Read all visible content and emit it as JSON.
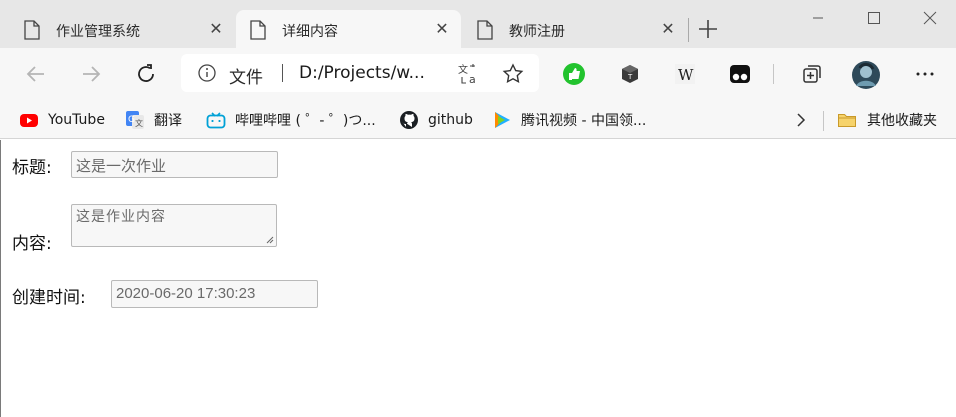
{
  "tabs": [
    {
      "title": "作业管理系统",
      "close": "✕"
    },
    {
      "title": "详细内容",
      "close": "✕"
    },
    {
      "title": "教师注册",
      "close": "✕"
    }
  ],
  "address_bar": {
    "security_label": "文件",
    "url": "D:/Projects/w..."
  },
  "bookmarks": [
    {
      "label": "YouTube",
      "icon": "youtube-icon"
    },
    {
      "label": "翻译",
      "icon": "google-translate-icon"
    },
    {
      "label": "哔哩哔哩 ( ゜- ゜)つ...",
      "icon": "bilibili-icon"
    },
    {
      "label": "github",
      "icon": "github-icon"
    },
    {
      "label": "腾讯视频 - 中国领...",
      "icon": "tencent-video-icon"
    }
  ],
  "other_bookmarks": {
    "label": "其他收藏夹",
    "icon": "folder-icon"
  },
  "form": {
    "title_label": "标题:",
    "title_value": "这是一次作业",
    "content_label": "内容:",
    "content_value": "这是作业内容",
    "created_label": "创建时间:",
    "created_value": "2020-06-20 17:30:23"
  },
  "colors": {
    "tabstrip_bg": "#e7e7e7",
    "toolbar_bg": "#f7f7f7",
    "youtube_red": "#ff0000",
    "bilibili_blue": "#00a1d6",
    "extension_green": "#22c32e"
  }
}
